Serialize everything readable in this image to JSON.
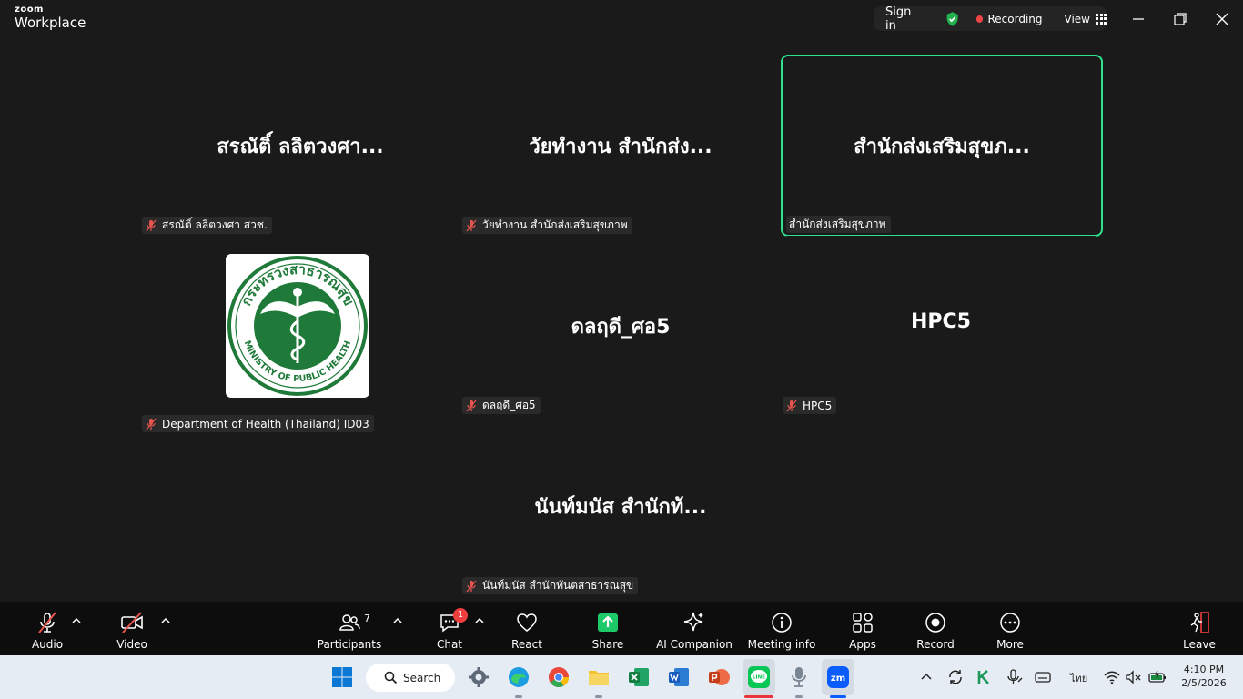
{
  "app": {
    "logo_top": "zoom",
    "logo_bottom": "Workplace"
  },
  "status": {
    "sign_in": "Sign in",
    "recording": "Recording",
    "view": "View"
  },
  "participants": [
    {
      "display": "สรณัติ์ ลลิตวงศา...",
      "tag": "สรณัติ์ ลลิตวงศา สวช.",
      "muted": true,
      "active": false
    },
    {
      "display": "วัยทำงาน สำนักส่ง...",
      "tag": "วัยทำงาน สำนักส่งเสริมสุขภาพ",
      "muted": true,
      "active": false
    },
    {
      "display": "สำนักส่งเสริมสุขภ...",
      "tag": "สำนักส่งเสริมสุขภาพ",
      "muted": false,
      "active": true
    },
    {
      "display": "",
      "tag": "Department of Health (Thailand) ID03",
      "muted": true,
      "active": false,
      "seal_text_top": "กระทรวงสาธารณสุข",
      "seal_text_bottom": "MINISTRY OF PUBLIC HEALTH"
    },
    {
      "display": "ดลฤดี_ศอ5",
      "tag": "ดลฤดี_ศอ5",
      "muted": true,
      "active": false
    },
    {
      "display": "HPC5",
      "tag": "HPC5",
      "muted": true,
      "active": false
    },
    {
      "display": "นันท์มนัส สำนักท้...",
      "tag": "นันท์มนัส สำนักทันตสาธารณสุข",
      "muted": true,
      "active": false
    }
  ],
  "toolbar": {
    "audio": "Audio",
    "video": "Video",
    "participants": "Participants",
    "participants_count": "7",
    "chat": "Chat",
    "chat_badge": "1",
    "react": "React",
    "share": "Share",
    "ai_companion": "AI Companion",
    "meeting_info": "Meeting info",
    "apps": "Apps",
    "record": "Record",
    "more": "More",
    "leave": "Leave"
  },
  "taskbar": {
    "search": "Search",
    "language": "ไทย",
    "time": "4:10 PM",
    "date": "2/5/2026",
    "line_label": "LINE",
    "zoom_label": "zm"
  },
  "colors": {
    "active_border": "#2ee28b",
    "share_green": "#1ec96a",
    "seal_green": "#1f7a3a",
    "recording_red": "#ef4444"
  }
}
